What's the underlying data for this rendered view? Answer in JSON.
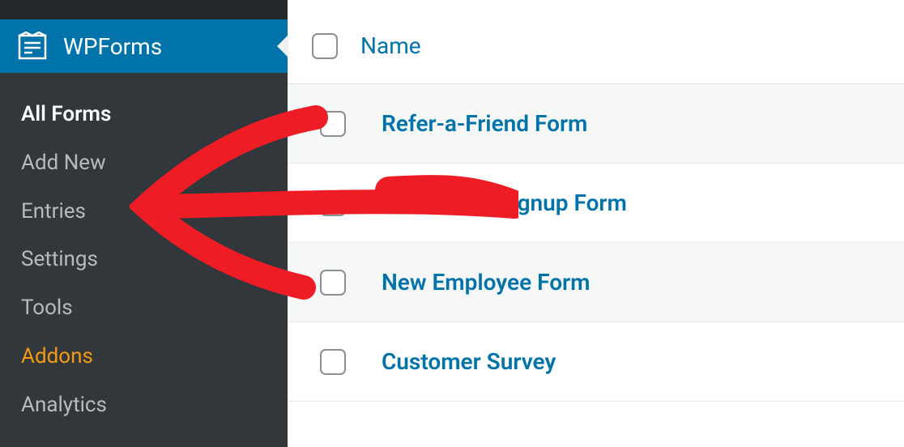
{
  "sidebar": {
    "main_label": "WPForms",
    "items": [
      {
        "label": "All Forms",
        "active": true
      },
      {
        "label": "Add New",
        "active": false
      },
      {
        "label": "Entries",
        "active": false
      },
      {
        "label": "Settings",
        "active": false
      },
      {
        "label": "Tools",
        "active": false
      },
      {
        "label": "Addons",
        "active": false,
        "addons": true
      },
      {
        "label": "Analytics",
        "active": false
      }
    ]
  },
  "table": {
    "header": "Name",
    "rows": [
      {
        "label": "Refer-a-Friend Form",
        "alt": true
      },
      {
        "label": "Newsletter Signup Form",
        "alt": false
      },
      {
        "label": "New Employee Form",
        "alt": true
      },
      {
        "label": "Customer Survey",
        "alt": false
      }
    ]
  },
  "colors": {
    "accent": "#0073aa",
    "sidebar_bg": "#32373c",
    "addons": "#f39c12"
  }
}
